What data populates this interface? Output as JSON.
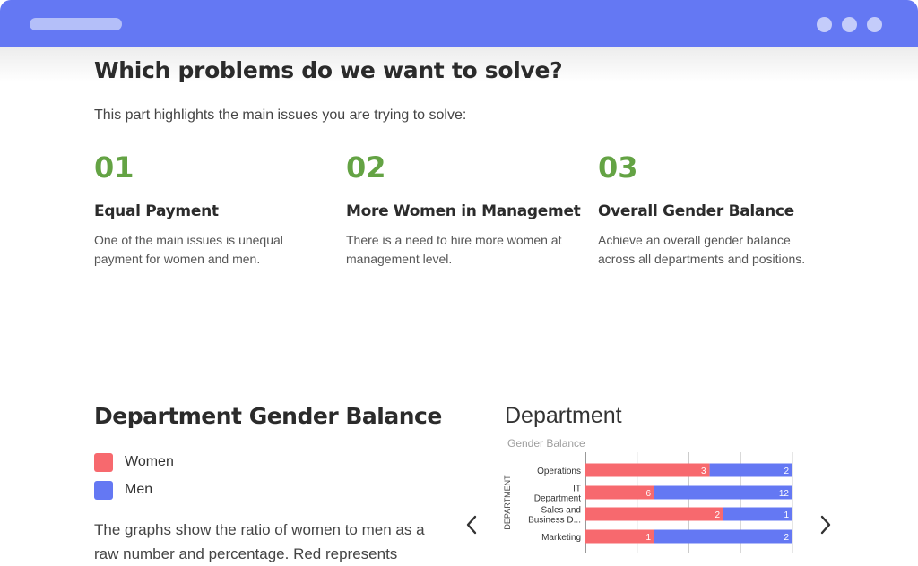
{
  "window": {
    "accent": "#6478f3"
  },
  "problems": {
    "heading": "Which problems do we want to solve?",
    "intro": "This part highlights the main issues you are trying to solve:",
    "items": [
      {
        "number": "01",
        "title": "Equal Payment",
        "desc": "One of the main issues is unequal payment for women and men."
      },
      {
        "number": "02",
        "title": "More Women in Managemet",
        "desc": "There is a need to hire more women at management level."
      },
      {
        "number": "03",
        "title": "Overall Gender Balance",
        "desc": "Achieve an overall gender balance across all departments and positions."
      }
    ]
  },
  "department": {
    "heading": "Department Gender Balance",
    "legend": [
      {
        "label": "Women",
        "color": "#f7696e"
      },
      {
        "label": "Men",
        "color": "#6478f3"
      }
    ],
    "paragraph": "The graphs show the ratio of women to men as a raw number and percentage. Red represents"
  },
  "carousel": {
    "prev_icon": "chevron-left-icon",
    "next_icon": "chevron-right-icon"
  },
  "chart_data": {
    "type": "bar",
    "orientation": "horizontal",
    "stacked": true,
    "title": "Department",
    "subtitle": "Gender Balance",
    "ylabel": "DEPARTMENT",
    "categories": [
      "Operations",
      "IT Department",
      "Sales and Business D...",
      "Marketing"
    ],
    "category_lines": [
      [
        "Operations"
      ],
      [
        "IT",
        "Department"
      ],
      [
        "Sales and",
        "Business D..."
      ],
      [
        "Marketing"
      ]
    ],
    "series": [
      {
        "name": "Women",
        "color": "#f7696e",
        "values": [
          3,
          6,
          2,
          1
        ]
      },
      {
        "name": "Men",
        "color": "#6478f3",
        "values": [
          2,
          12,
          1,
          2
        ]
      }
    ],
    "percent_stacked": true,
    "grid": true
  }
}
